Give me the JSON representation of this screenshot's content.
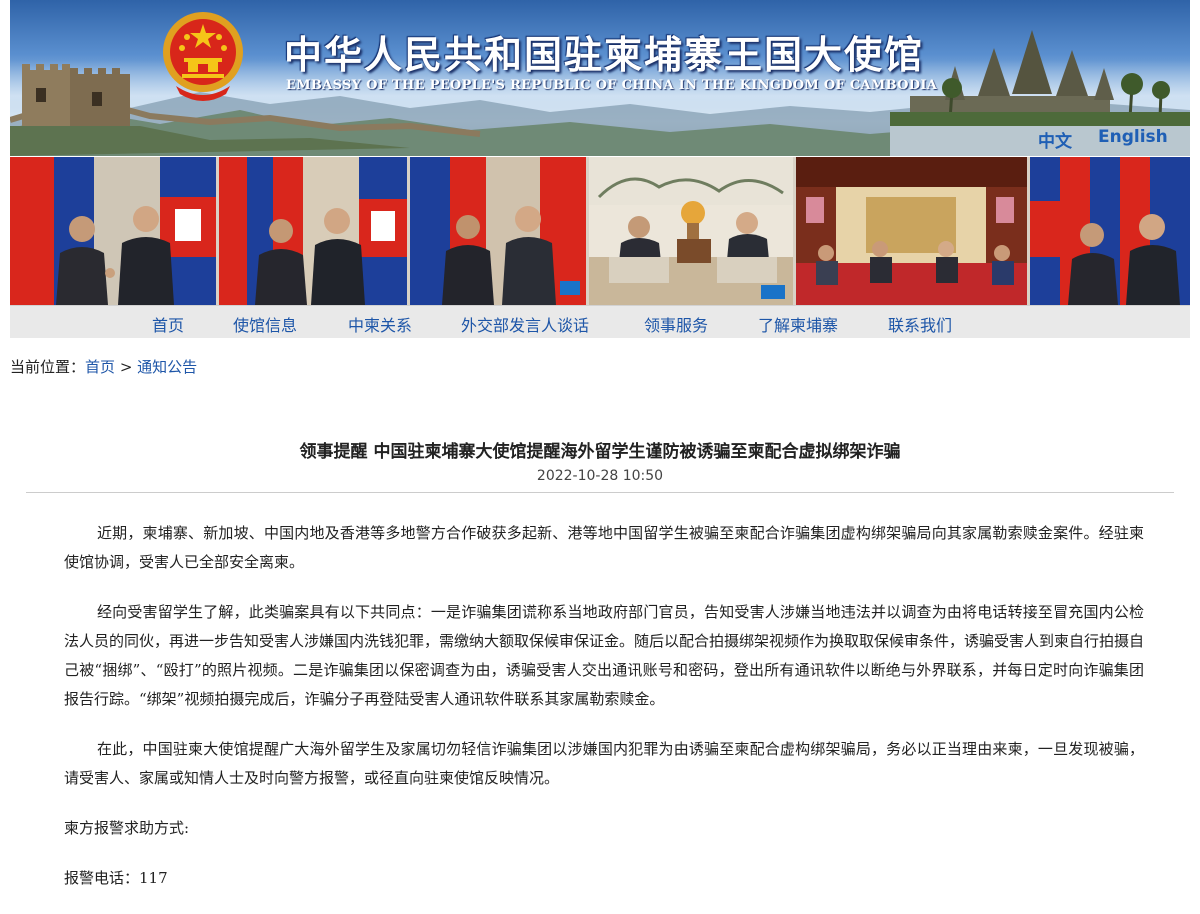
{
  "header": {
    "title_cn": "中华人民共和国驻柬埔寨王国大使馆",
    "title_en": "EMBASSY OF THE PEOPLE'S REPUBLIC OF CHINA IN THE KINGDOM OF CAMBODIA",
    "languages": [
      "中文",
      "English"
    ]
  },
  "photos": [
    "leaders-handshake-1",
    "leaders-handshake-2",
    "leaders-handshake-3",
    "leaders-meeting-seated",
    "palace-meeting-room",
    "leaders-handshake-4"
  ],
  "nav": {
    "items": [
      "首页",
      "使馆信息",
      "中柬关系",
      "外交部发言人谈话",
      "领事服务",
      "了解柬埔寨",
      "联系我们"
    ]
  },
  "breadcrumb": {
    "prefix": "当前位置：",
    "home": "首页",
    "separator": ">",
    "current": "通知公告"
  },
  "article": {
    "title": "领事提醒 中国驻柬埔寨大使馆提醒海外留学生谨防被诱骗至柬配合虚拟绑架诈骗",
    "date": "2022-10-28 10:50",
    "paragraphs": [
      "近期，柬埔寨、新加坡、中国内地及香港等多地警方合作破获多起新、港等地中国留学生被骗至柬配合诈骗集团虚构绑架骗局向其家属勒索赎金案件。经驻柬使馆协调，受害人已全部安全离柬。",
      "经向受害留学生了解，此类骗案具有以下共同点：一是诈骗集团谎称系当地政府部门官员，告知受害人涉嫌当地违法并以调查为由将电话转接至冒充国内公检法人员的同伙，再进一步告知受害人涉嫌国内洗钱犯罪，需缴纳大额取保候审保证金。随后以配合拍摄绑架视频作为换取取保候审条件，诱骗受害人到柬自行拍摄自己被“捆绑”、“殴打”的照片视频。二是诈骗集团以保密调查为由，诱骗受害人交出通讯账号和密码，登出所有通讯软件以断绝与外界联系，并每日定时向诈骗集团报告行踪。“绑架”视频拍摄完成后，诈骗分子再登陆受害人通讯软件联系其家属勒索赎金。",
      "在此，中国驻柬大使馆提醒广大海外留学生及家属切勿轻信诈骗集团以涉嫌国内犯罪为由诱骗至柬配合虚构绑架骗局，务必以正当理由来柬，一旦发现被骗，请受害人、家属或知情人士及时向警方报警，或径直向驻柬使馆反映情况。"
    ],
    "contact_heading": "柬方报警求助方式:",
    "police_phone": "报警电话：117"
  },
  "colors": {
    "link": "#1e56a8",
    "nav_bg": "#e9e9e9",
    "flag_red": "#de2910",
    "cambodia_blue": "#032ea1"
  }
}
